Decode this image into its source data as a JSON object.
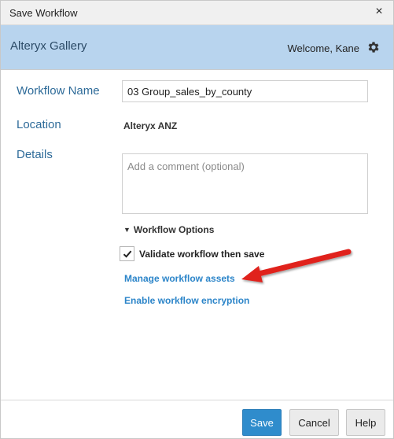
{
  "window": {
    "title": "Save Workflow",
    "close_glyph": "×"
  },
  "header": {
    "brand": "Alteryx Gallery",
    "welcome_prefix": "Welcome,",
    "user": "Kane",
    "settings_icon": "gear-icon"
  },
  "form": {
    "workflow_name_label": "Workflow Name",
    "workflow_name_value": "03 Group_sales_by_county",
    "location_label": "Location",
    "location_value": "Alteryx ANZ",
    "details_label": "Details",
    "details_placeholder": "Add a comment (optional)"
  },
  "options": {
    "toggle_label": "Workflow Options",
    "expanded": true,
    "validate_label": "Validate workflow then save",
    "validate_checked": true,
    "manage_assets_link": "Manage workflow assets",
    "encryption_link": "Enable workflow encryption"
  },
  "annotation": {
    "arrow_color": "#e0201c"
  },
  "footer": {
    "save_label": "Save",
    "cancel_label": "Cancel",
    "help_label": "Help"
  },
  "colors": {
    "header_bg": "#b8d4ee",
    "label": "#2e6b99",
    "link": "#2c85c9",
    "primary_button": "#2f8ccc"
  }
}
